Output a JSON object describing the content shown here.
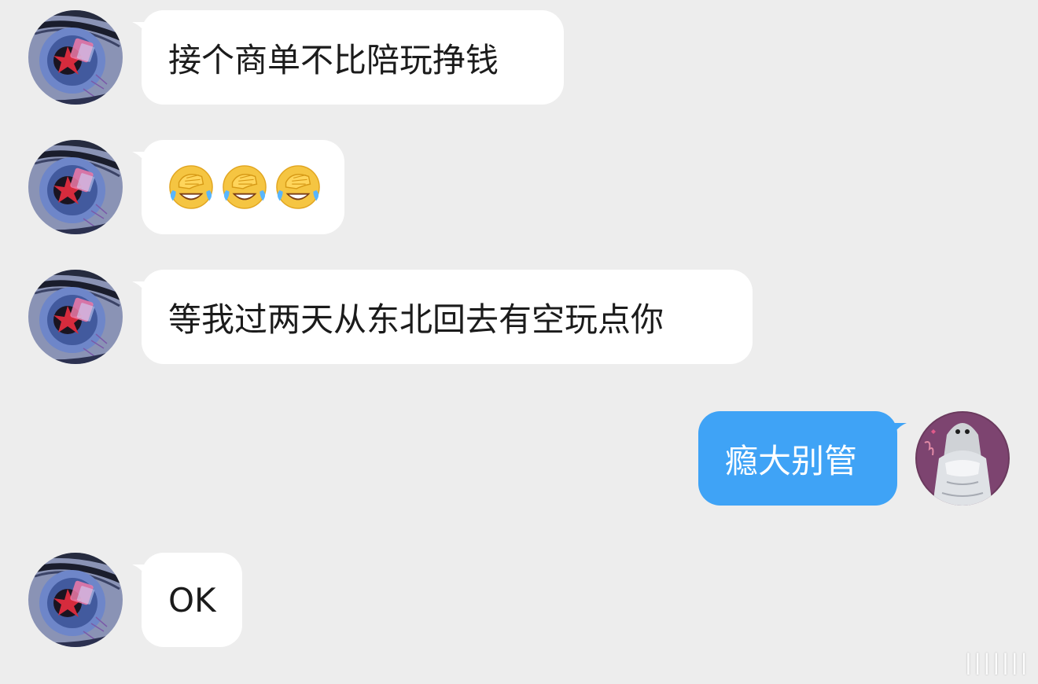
{
  "conversation": {
    "messages": [
      {
        "sender": "other",
        "text": "接个商单不比陪玩挣钱"
      },
      {
        "sender": "other",
        "emoji": "facepalm-laugh-cry",
        "emoji_count": 3
      },
      {
        "sender": "other",
        "text": "等我过两天从东北回去有空玩点你"
      },
      {
        "sender": "self",
        "text": "瘾大别管"
      },
      {
        "sender": "other",
        "text": "OK"
      }
    ]
  },
  "colors": {
    "background": "#ededed",
    "incoming_bubble": "#ffffff",
    "outgoing_bubble": "#3fa3f6"
  },
  "watermark": {
    "text": "|||||||",
    "icon": "platform-watermark"
  }
}
